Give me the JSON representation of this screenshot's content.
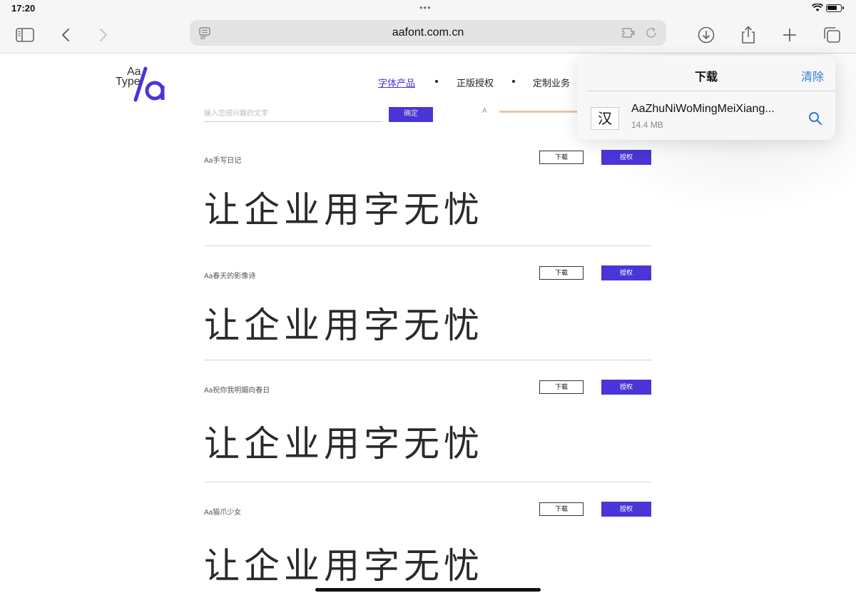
{
  "status": {
    "time": "17:20",
    "dots": "•••"
  },
  "browser": {
    "url": "aafont.com.cn"
  },
  "site": {
    "logo_top": "Aa",
    "logo_bottom": "Type",
    "nav": [
      {
        "label": "字体产品",
        "active": true
      },
      {
        "label": "正版授权"
      },
      {
        "label": "定制业务"
      }
    ],
    "search_placeholder": "输入您感兴趣的文字",
    "search_button": "确定",
    "size_label": "A"
  },
  "fonts": [
    {
      "name": "Aa手写日记",
      "sample": "让企业用字无忧",
      "download": "下载",
      "license": "授权"
    },
    {
      "name": "Aa春天的影像诗",
      "sample": "让企业用字无忧",
      "download": "下载",
      "license": "授权"
    },
    {
      "name": "Aa祝你我明媚向春日",
      "sample": "让企业用字无忧",
      "download": "下载",
      "license": "授权"
    },
    {
      "name": "Aa猫爪少女",
      "sample": "让企业用字无忧",
      "download": "下载",
      "license": "授权"
    }
  ],
  "downloads": {
    "title": "下载",
    "clear": "清除",
    "file": {
      "icon_glyph": "汉",
      "name": "AaZhuNiWoMingMeiXiang...",
      "size": "14.4 MB"
    }
  },
  "colors": {
    "accent": "#4a35d8",
    "link": "#2d7be0"
  },
  "icons": [
    "sidebar-icon",
    "back-icon",
    "forward-icon",
    "reader-icon",
    "extensions-icon",
    "reload-icon",
    "download-icon",
    "share-icon",
    "plus-icon",
    "tabs-icon",
    "search-icon"
  ]
}
